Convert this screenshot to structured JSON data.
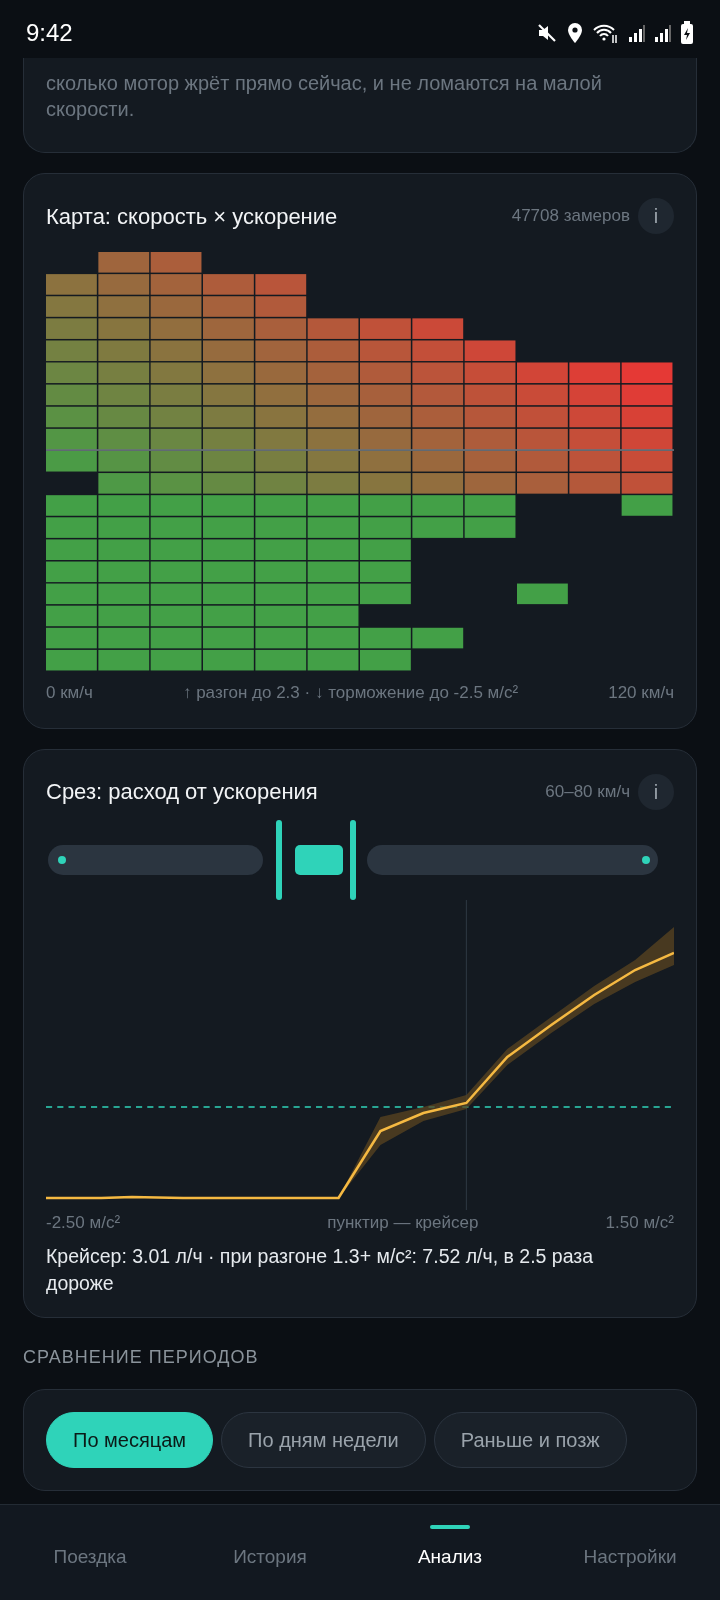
{
  "status_bar": {
    "time": "9:42"
  },
  "intro_card": {
    "text": "сколько мотор жрёт прямо сейчас, и не ломаются на малой скорости."
  },
  "heatmap_card": {
    "title": "Карта: скорость × ускорение",
    "count": "47708 замеров",
    "info": "i",
    "footer": {
      "left": "0 км/ч",
      "middle": "↑ разгон до 2.3 · ↓ торможение до -2.5 м/с²",
      "right": "120 км/ч"
    }
  },
  "slice_card": {
    "title": "Срез: расход от ускорения",
    "range": "60–80 км/ч",
    "info": "i",
    "slider": {
      "handles": [
        {
          "level": 0.38
        },
        {
          "level": 0.5
        }
      ]
    },
    "axis": {
      "left": "-2.50 м/с²",
      "middle": "пунктир — крейсер",
      "right": "1.50 м/с²"
    },
    "summary": "Крейсер: 3.01 л/ч · при разгоне 1.3+ м/с²: 7.52 л/ч, в 2.5 раза дороже"
  },
  "comparison": {
    "heading": "СРАВНЕНИЕ ПЕРИОДОВ",
    "chips": [
      {
        "label": "По месяцам",
        "selected": true
      },
      {
        "label": "По дням недели",
        "selected": false
      },
      {
        "label": "Раньше и позж",
        "selected": false
      }
    ]
  },
  "bottom_nav": [
    {
      "label": "Поездка",
      "selected": false
    },
    {
      "label": "История",
      "selected": false
    },
    {
      "label": "Анализ",
      "selected": true
    },
    {
      "label": "Настройки",
      "selected": false
    }
  ]
}
